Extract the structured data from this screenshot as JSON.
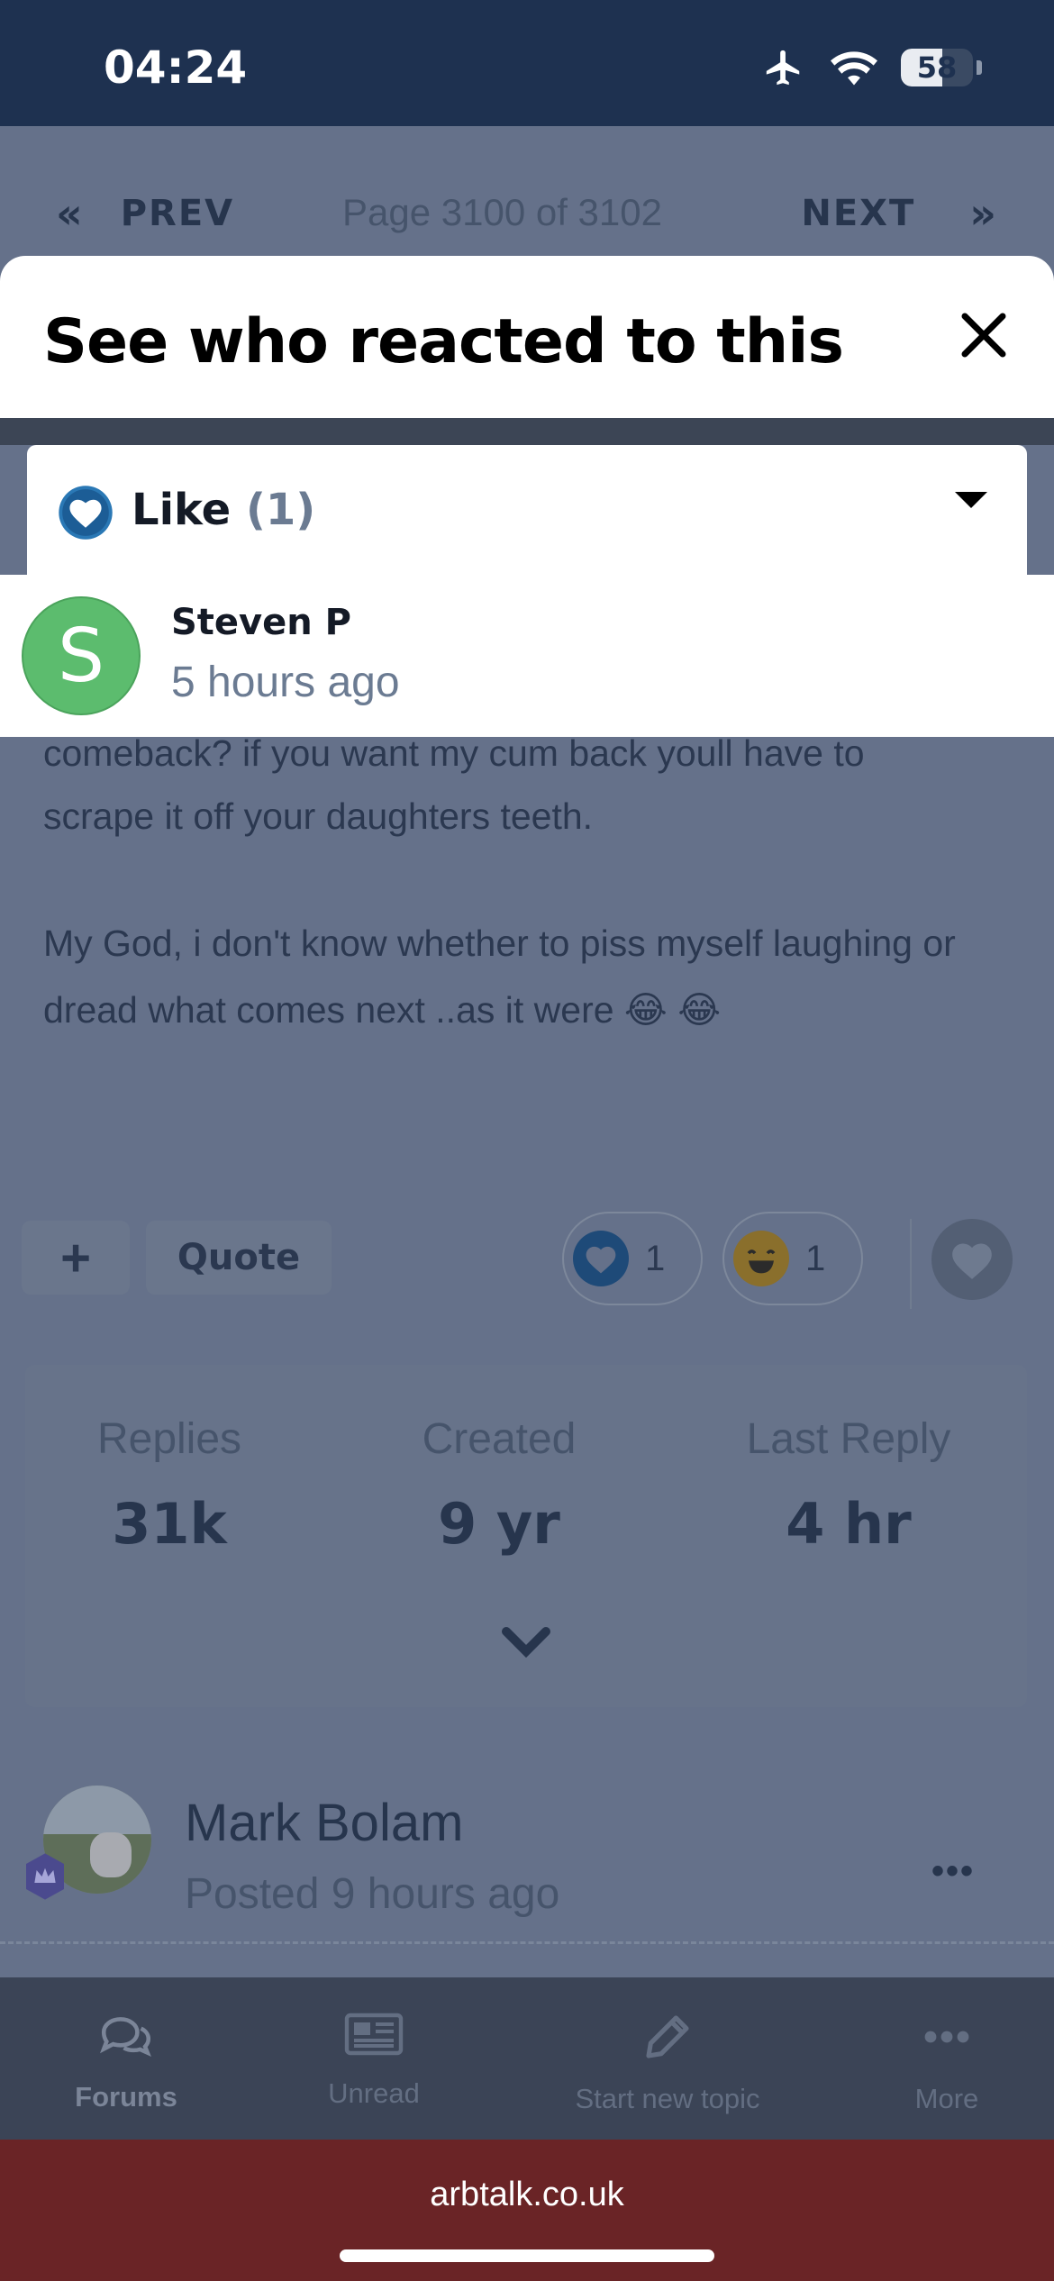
{
  "status_bar": {
    "time": "04:24",
    "battery": "58",
    "battery_level": 0.58
  },
  "pager": {
    "prev_label": "PREV",
    "page_info": "Page 3100 of 3102",
    "next_label": "NEXT"
  },
  "post": {
    "line1": "comeback? if you want my cum back youll have to",
    "line2": "scrape it off your daughters teeth.",
    "para2": "My God,  i don't know whether to piss myself laughing or dread what comes next ..as it were 😂 😂"
  },
  "actions": {
    "plus_label": "+",
    "quote_label": "Quote",
    "like_count": "1",
    "haha_count": "1"
  },
  "stats": {
    "replies_label": "Replies",
    "replies_value": "31k",
    "created_label": "Created",
    "created_value": "9 yr",
    "last_reply_label": "Last Reply",
    "last_reply_value": "4 hr"
  },
  "author": {
    "name": "Mark Bolam",
    "meta": "Posted 9 hours ago",
    "more": "•••"
  },
  "nav": [
    {
      "label": "Forums",
      "icon": "chat-bubbles-icon"
    },
    {
      "label": "Unread",
      "icon": "newspaper-icon"
    },
    {
      "label": "Start new topic",
      "icon": "pencil-icon"
    },
    {
      "label": "More",
      "icon": "ellipsis-icon"
    }
  ],
  "url": "arbtalk.co.uk",
  "modal": {
    "title": "See who reacted to this",
    "filter_label": "Like",
    "filter_count": "(1)",
    "reactor": {
      "initial": "S",
      "name": "Steven P",
      "time": "5 hours ago"
    }
  },
  "colors": {
    "status_bar": "#1e3150",
    "like_blue": "#2a78b5",
    "avatar_green": "#5cbc6e",
    "url_bar": "#6a2426"
  }
}
